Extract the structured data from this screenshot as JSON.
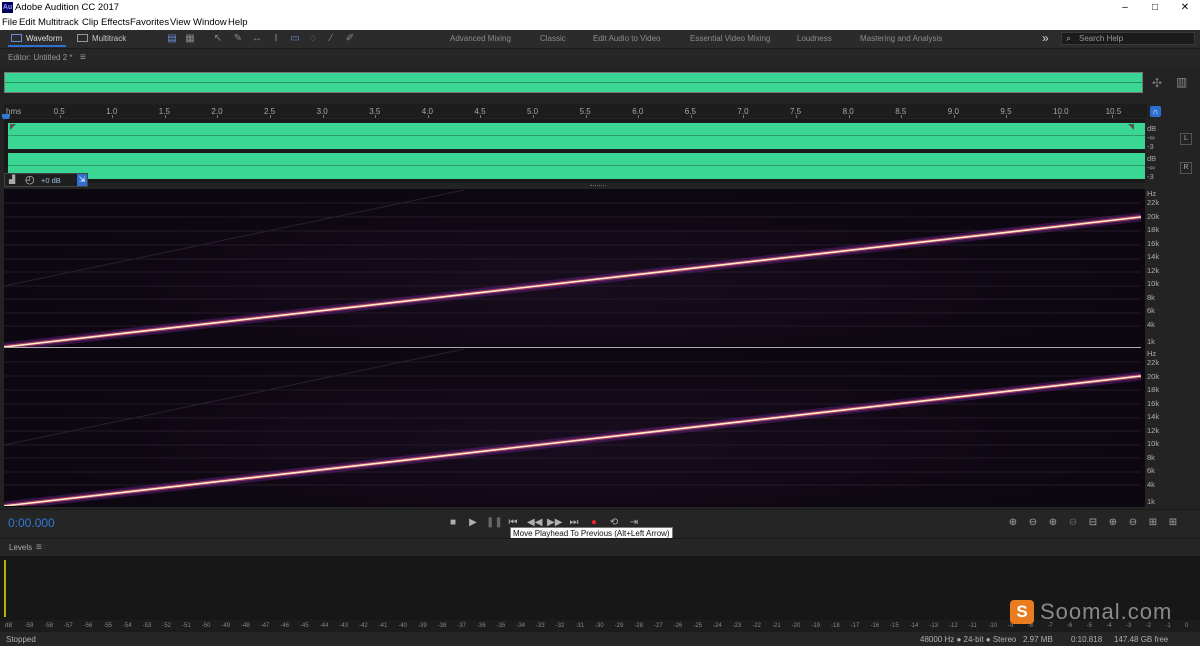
{
  "window": {
    "title": "Adobe Audition CC 2017",
    "app_icon_text": "Au",
    "minimize_glyph": "–",
    "maximize_glyph": "□",
    "close_glyph": "✕"
  },
  "menu": [
    "File",
    "Edit",
    "Multitrack",
    "Clip",
    "Effects",
    "Favorites",
    "View",
    "Window",
    "Help"
  ],
  "toolbar": {
    "view_tabs": [
      "Waveform",
      "Multitrack"
    ],
    "workspaces": [
      "Advanced Mixing",
      "Classic",
      "Edit Audio to Video",
      "Essential Video Mixing",
      "Loudness",
      "Mastering and Analysis"
    ],
    "overflow_glyph": "»",
    "search_placeholder": "Search Help"
  },
  "editor": {
    "label": "Editor: Untitled 2 *",
    "menu_glyph": "≡"
  },
  "ruler": {
    "unit": "hms",
    "ticks": [
      "0.5",
      "1.0",
      "1.5",
      "2.0",
      "2.5",
      "3.0",
      "3.5",
      "4.0",
      "4.5",
      "5.0",
      "5.5",
      "6.0",
      "6.5",
      "7.0",
      "7.5",
      "8.0",
      "8.5",
      "9.0",
      "9.5",
      "10.0",
      "10.5"
    ]
  },
  "waveform": {
    "db_label": "dB",
    "db_inf": "-∞",
    "db_minus3": "-3",
    "left_channel": "L",
    "right_channel": "R",
    "gain_value": "+0 dB"
  },
  "spectral": {
    "hz_label": "Hz",
    "hz_ticks": [
      "22k",
      "20k",
      "18k",
      "16k",
      "14k",
      "12k",
      "10k",
      "8k",
      "6k",
      "4k",
      "1k"
    ]
  },
  "transport": {
    "timecode": "0:00.000",
    "tooltip": "Move Playhead To Previous (Alt+Left Arrow)"
  },
  "levels": {
    "title": "Levels",
    "menu_glyph": "≡",
    "scale": [
      "dB",
      "-59",
      "-58",
      "-57",
      "-56",
      "-55",
      "-54",
      "-53",
      "-52",
      "-51",
      "-50",
      "-49",
      "-48",
      "-47",
      "-46",
      "-45",
      "-44",
      "-43",
      "-42",
      "-41",
      "-40",
      "-39",
      "-38",
      "-37",
      "-36",
      "-35",
      "-34",
      "-33",
      "-32",
      "-31",
      "-30",
      "-29",
      "-28",
      "-27",
      "-26",
      "-25",
      "-24",
      "-23",
      "-22",
      "-21",
      "-20",
      "-19",
      "-18",
      "-17",
      "-16",
      "-15",
      "-14",
      "-13",
      "-12",
      "-11",
      "-10",
      "-9",
      "-8",
      "-7",
      "-6",
      "-5",
      "-4",
      "-3",
      "-2",
      "-1",
      "0"
    ]
  },
  "status": {
    "state": "Stopped",
    "format": "48000 Hz ● 24-bit ● Stereo",
    "size": "2.97 MB",
    "duration": "0:10.818",
    "free": "147.48 GB free"
  },
  "watermark": {
    "icon_letter": "S",
    "text": "Soomal.com"
  },
  "colors": {
    "waveform_green": "#3ad694",
    "accent_blue": "#2e7bd6",
    "record_red": "#e0262a",
    "sweep_core": "#fff3c4"
  }
}
